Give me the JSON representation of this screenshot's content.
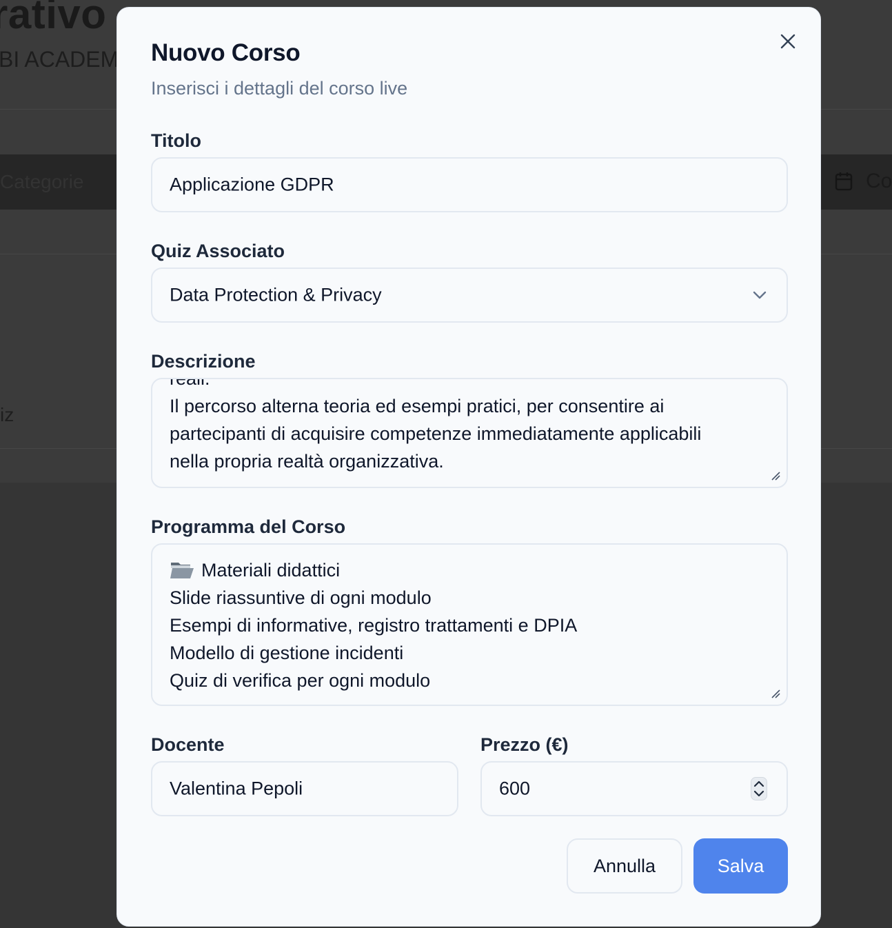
{
  "background": {
    "heading": "rativo",
    "subheading": "BI ACADEM",
    "tab_left": "Categorie",
    "tab_right": "Co",
    "side_text": "iz"
  },
  "dialog": {
    "title": "Nuovo Corso",
    "subtitle": "Inserisci i dettagli del corso live",
    "titolo": {
      "label": "Titolo",
      "value": "Applicazione GDPR"
    },
    "quiz": {
      "label": "Quiz Associato",
      "value": "Data Protection & Privacy"
    },
    "descrizione": {
      "label": "Descrizione",
      "lines": [
        "reali.",
        "Il percorso alterna teoria ed esempi pratici, per consentire ai",
        "partecipanti di acquisire competenze immediatamente applicabili",
        "nella propria realtà organizzativa."
      ]
    },
    "programma": {
      "label": "Programma del Corso",
      "lines": [
        "Materiali didattici",
        "Slide riassuntive di ogni modulo",
        "Esempi di informative, registro trattamenti e DPIA",
        "Modello di gestione incidenti",
        "Quiz di verifica per ogni modulo"
      ]
    },
    "docente": {
      "label": "Docente",
      "value": "Valentina Pepoli"
    },
    "prezzo": {
      "label": "Prezzo (€)",
      "value": "600"
    },
    "buttons": {
      "cancel": "Annulla",
      "save": "Salva"
    }
  }
}
